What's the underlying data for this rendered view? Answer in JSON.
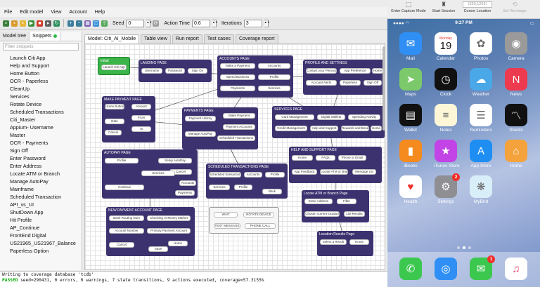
{
  "menu": [
    "File",
    "Edit model",
    "View",
    "Account",
    "Help"
  ],
  "toolbar": {
    "seed_label": "Seed",
    "seed_value": "0",
    "action_time_label": "Action Time",
    "action_time_value": "0.6",
    "iterations_label": "Iterations",
    "iterations_value": "3"
  },
  "sidebar": {
    "tabs": [
      "Model tree",
      "Snippets"
    ],
    "filter_placeholder": "Filter snippets",
    "items": [
      "Launch Citi App",
      "Help and Support",
      "Home Button",
      "OCR - Paperless",
      "CleanUp",
      "Services",
      "Rotate Device",
      "Scheduled Transactions",
      "Citi_Master",
      "Appium- Username",
      "Master",
      "OCR - Payments",
      "Sign Off",
      "Enter Password",
      "Enter Address",
      "Locate ATM or Branch",
      "Manage AutoPay",
      "Mainframe",
      "Scheduled Transaction",
      "API_vs_UI",
      "ShutDown App",
      "Hit Profile",
      "AP_Continue",
      "FrontEnd Digital",
      "US21965_US21967_Balance",
      "Paperless Option"
    ]
  },
  "main_tabs": [
    "Model: Citi_AI_Mobile",
    "Table view",
    "Run report",
    "Test cases",
    "Coverage report"
  ],
  "states": {
    "initial": {
      "title": "Initial",
      "actions": [
        "Launch Citi App"
      ]
    },
    "landing": {
      "title": "LANDING PAGE",
      "actions": [
        "Username",
        "Password",
        "Sign On"
      ]
    },
    "accounts": {
      "title": "ACCOUNTS PAGE",
      "actions": [
        "Make a Payment",
        "Accounts",
        "Spend Business",
        "Profile",
        "Payments",
        "Services"
      ]
    },
    "profile": {
      "title": "PROFILE AND SETTINGS",
      "actions": [
        "Contact your Personal",
        "App Preference",
        "Home",
        "Account Alerts",
        "Paperless",
        "Sign Off"
      ]
    },
    "make_payment": {
      "title": "MAKE PAYMENT PAGE",
      "actions": [
        "Home Button",
        "Amount",
        "From",
        "Date",
        "Cancel",
        "To"
      ]
    },
    "payments": {
      "title": "PAYMENTS PAGE",
      "actions": [
        "Payment History",
        "Make Payment",
        "Payment Accounts",
        "Manage AutoPay",
        "Scheduled Transactions"
      ]
    },
    "services": {
      "title": "SERVICES PAGE",
      "actions": [
        "Card Management",
        "Digital Wallets",
        "Spending Activity",
        "Home",
        "Credit Management",
        "Help and Support",
        "Rewards and Benefits"
      ]
    },
    "autopay": {
      "title": "AUTOPAY PAGE",
      "actions": [
        "Profile",
        "Setup AutoPay",
        "Cancel",
        "Services",
        "Accounts",
        "Continue",
        "Payments"
      ]
    },
    "scheduled": {
      "title": "SCHEDULED TRANSACTIONS PAGE",
      "actions": [
        "Scheduled transactions",
        "Accounts",
        "Profile",
        "Services",
        "Profile",
        "Back"
      ]
    },
    "help": {
      "title": "HELP AND SUPPORT PAGE",
      "actions": [
        "Home",
        "FAQs",
        "Phone or Email",
        "App Feedback",
        "Locate ATM or Branch",
        "Message US"
      ]
    },
    "misc": {
      "actions": [
        "WAIT",
        "ROTATE DEVICE",
        "TEXT MESSAGE",
        "PHONE CALL"
      ]
    },
    "new_payment": {
      "title": "NEW PAYMENT ACCOUNT PAGE",
      "actions": [
        "Bank Routing Num",
        "Checking or Money Market",
        "Account Number",
        "Primary Payment Account",
        "Home",
        "Cancel",
        "Save"
      ]
    },
    "locate": {
      "title": "Locate ATM or Branch Page",
      "actions": [
        "Enter Address",
        "Filter",
        "Chosen current location",
        "List Results"
      ]
    },
    "location_results": {
      "title": "Location Results Page",
      "actions": [
        "Select a Result",
        "Home"
      ]
    }
  },
  "console": {
    "line1": "Writing to coverage database 'tcdb'",
    "status": "PASSED",
    "line2": " seed=290431, 0 errors, 0 warnings, 7 state transitions, 9 actions executed,  coverage=57.3155%"
  },
  "simulator": {
    "tools": [
      "Enter Capture Mode",
      "Start Session",
      "Cursor Location",
      "Set Recharge"
    ],
    "cursor_value": "(359,1263)",
    "status_time": "9:27 PM",
    "apps": [
      {
        "label": "Mail",
        "icon": "mail-icon",
        "color": "#2f8ff4"
      },
      {
        "label": "Calendar",
        "icon": "calendar-icon",
        "color": "#ffffff",
        "day": "Monday",
        "date": "19"
      },
      {
        "label": "Photos",
        "icon": "photos-icon",
        "color": "#ffffff"
      },
      {
        "label": "Camera",
        "icon": "camera-icon",
        "color": "#9a9a9a"
      },
      {
        "label": "Maps",
        "icon": "maps-icon",
        "color": "#7bc96a"
      },
      {
        "label": "Clock",
        "icon": "clock-icon",
        "color": "#111111"
      },
      {
        "label": "Weather",
        "icon": "weather-icon",
        "color": "#4aa7e8"
      },
      {
        "label": "News",
        "icon": "news-icon",
        "color": "#ee3a4e"
      },
      {
        "label": "Wallet",
        "icon": "wallet-icon",
        "color": "#111111"
      },
      {
        "label": "Notes",
        "icon": "notes-icon",
        "color": "#fdf7d8"
      },
      {
        "label": "Reminders",
        "icon": "reminders-icon",
        "color": "#ffffff"
      },
      {
        "label": "Stocks",
        "icon": "stocks-icon",
        "color": "#111111"
      },
      {
        "label": "iBooks",
        "icon": "ibooks-icon",
        "color": "#f58a1f"
      },
      {
        "label": "iTunes Store",
        "icon": "itunes-icon",
        "color": "#c244e6"
      },
      {
        "label": "App Store",
        "icon": "appstore-icon",
        "color": "#1e8ef3"
      },
      {
        "label": "Home",
        "icon": "home-icon",
        "color": "#f4a23b"
      },
      {
        "label": "Health",
        "icon": "health-icon",
        "color": "#ffffff"
      },
      {
        "label": "Settings",
        "icon": "settings-icon",
        "color": "#8e8e93",
        "badge": "2"
      },
      {
        "label": "MyBird",
        "icon": "mybird-icon",
        "color": "#d8eef8"
      }
    ],
    "dock": [
      {
        "label": "Phone",
        "icon": "phone-icon",
        "color": "#3cc84f"
      },
      {
        "label": "Safari",
        "icon": "safari-icon",
        "color": "#2f8ff4"
      },
      {
        "label": "Messages",
        "icon": "messages-icon",
        "color": "#3cc84f",
        "badge": "1"
      },
      {
        "label": "Music",
        "icon": "music-icon",
        "color": "#ffffff"
      }
    ]
  }
}
